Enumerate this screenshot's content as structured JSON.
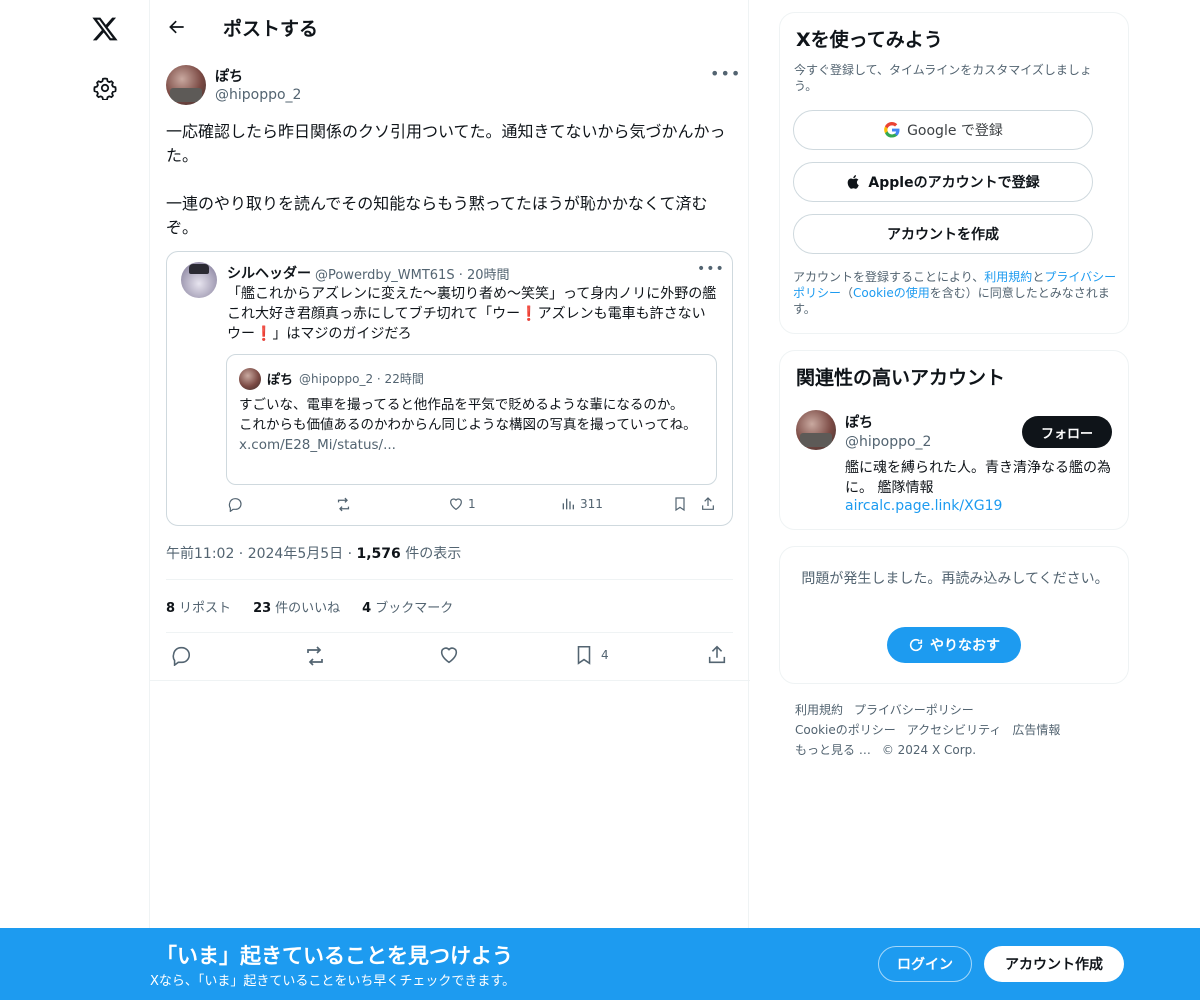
{
  "nav": {
    "logo_icon": "x-logo-icon",
    "settings_icon": "gear-icon"
  },
  "header": {
    "title": "ポストする",
    "back_icon": "arrow-left-icon"
  },
  "post": {
    "author_name": "ぽち",
    "author_handle": "@hipoppo_2",
    "text": "一応確認したら昨日関係のクソ引用ついてた。通知きてないから気づかんかった。\n\n一連のやり取りを読んでその知能ならもう黙ってたほうが恥かかなくて済むぞ。",
    "timestamp": "午前11:02 · 2024年5月5日 ·",
    "views_count": "1,576",
    "views_label": "件の表示",
    "stats": {
      "reposts_count": "8",
      "reposts_label": "リポスト",
      "likes_count": "23",
      "likes_label": "件のいいね",
      "bookmarks_count": "4",
      "bookmarks_label": "ブックマーク"
    },
    "actions": {
      "bookmark_count": "4"
    }
  },
  "quote": {
    "author_name": "シルヘッダー",
    "meta": "@Powerdby_WMT61S · 20時間",
    "text_part1": "「艦これからアズレンに変えた〜裏切り者め〜笑笑」って身内ノリに外野の艦これ大好き君顔真っ赤にしてブチ切れて「ウー",
    "mark": "❗",
    "text_part2": "アズレンも電車も許さないウー",
    "text_part3": "」はマジのガイジだろ",
    "inner": {
      "author_name": "ぽち",
      "meta": "@hipoppo_2 · 22時間",
      "text_line1": "すごいな、電車を撮ってると他作品を平気で貶めるような輩になるのか。",
      "text_line2": "これからも価値あるのかわからん同じような構図の写真を撮っていってね。",
      "link": "x.com/E28_Mi/status/..."
    },
    "actions": {
      "likes": "1",
      "views": "311"
    }
  },
  "signup_card": {
    "title": "Xを使ってみよう",
    "subtitle": "今すぐ登録して、タイムラインをカスタマイズしましょう。",
    "google_label": "Google で登録",
    "apple_label": "Appleのアカウントで登録",
    "create_label": "アカウントを作成",
    "legal_pre": "アカウントを登録することにより、",
    "legal_terms": "利用規約",
    "legal_and": "と",
    "legal_privacy": "プライバシーポリシー",
    "legal_paren_open": "（",
    "legal_cookie": "Cookieの使用",
    "legal_post": "を含む）に同意したとみなされます。"
  },
  "related": {
    "title": "関連性の高いアカウント",
    "name": "ぽち",
    "handle": "@hipoppo_2",
    "follow_label": "フォロー",
    "bio": "艦に魂を縛られた人。青き清浄なる艦の為に。 艦隊情報",
    "link": "aircalc.page.link/XG19"
  },
  "error_card": {
    "message": "問題が発生しました。再読み込みしてください。",
    "retry_label": "やりなおす"
  },
  "footer": {
    "links": [
      "利用規約",
      "プライバシーポリシー",
      "Cookieのポリシー",
      "アクセシビリティ",
      "広告情報",
      "もっと見る …",
      "© 2024 X Corp."
    ]
  },
  "banner": {
    "title": "「いま」起きていることを見つけよう",
    "subtitle": "Xなら、「いま」起きていることをいち早くチェックできます。",
    "login_label": "ログイン",
    "signup_label": "アカウント作成"
  },
  "colors": {
    "accent": "#1d9bf0",
    "text": "#0f1419",
    "muted": "#536471",
    "border": "#cfd9de",
    "alert": "#e0243d"
  }
}
